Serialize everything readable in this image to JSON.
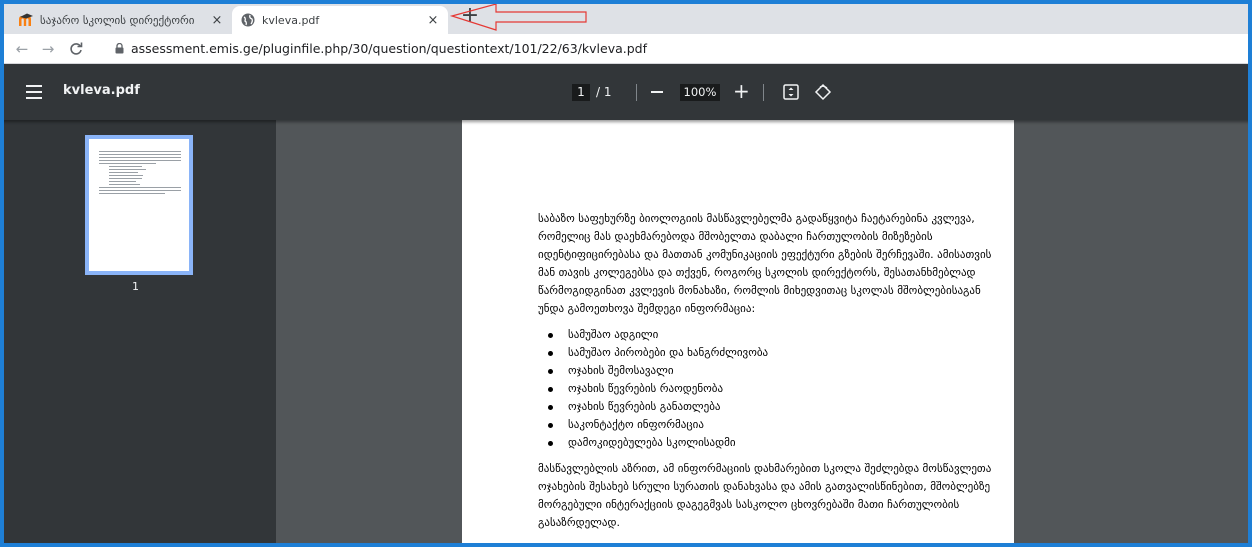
{
  "tabs": [
    {
      "title": "საჯარო სკოლის დირექტორი",
      "icon": "moodle-logo-icon",
      "active": false
    },
    {
      "title": "kvleva.pdf",
      "icon": "globe-icon",
      "active": true
    }
  ],
  "tab_close": "×",
  "new_tab": "+",
  "address_bar": {
    "url": "assessment.emis.ge/pluginfile.php/30/question/questiontext/101/22/63/kvleva.pdf"
  },
  "pdf_toolbar": {
    "title": "kvleva.pdf",
    "current_page": "1",
    "total_pages": "/ 1",
    "zoom": "100%"
  },
  "sidebar": {
    "thumbnail_label": "1"
  },
  "document": {
    "intro": "საბაზო საფეხურზე ბიოლოგიის მასწავლებელმა გადაწყვიტა ჩაეტარებინა კვლევა, რომელიც მას დაეხმარებოდა მშობელთა დაბალი ჩართულობის  მიზეზების იდენტიფიცირებასა და მათთან კომუნიკაციის ეფექტური გზების შერჩევაში. ამისათვის მან თავის კოლეგებსა და  თქვენ, როგორც სკოლის დირექტორს,  შესათანხმებლად წარმოგიდგინათ კვლევის მონახაზი, რომლის მიხედვითაც სკოლას მშობლებისაგან უნდა გამოეთხოვა შემდეგი ინფორმაცია:",
    "bullets": [
      "სამუშაო ადგილი",
      "სამუშაო პირობები და ხანგრძლივობა",
      "ოჯახის შემოსავალი",
      "ოჯახის წევრების რაოდენობა",
      "ოჯახის წევრების განათლება",
      "საკონტაქტო ინფორმაცია",
      "დამოკიდებულება სკოლისადმი"
    ],
    "conclusion": "მასწავლებლის აზრით, ამ ინფორმაციის დახმარებით სკოლა შეძლებდა მოსწავლეთა ოჯახების შესახებ სრული სურათის დანახვასა და ამის გათვალისწინებით,  მშობლებზე მორგებული ინტერაქციის დაგეგმვას სასკოლო ცხოვრებაში მათი ჩართულობის გასაზრდელად."
  },
  "colors": {
    "frame": "#1e7fd6",
    "annotation_arrow": "#e53935",
    "viewer_bg": "#525659",
    "toolbar_bg": "#323639"
  }
}
